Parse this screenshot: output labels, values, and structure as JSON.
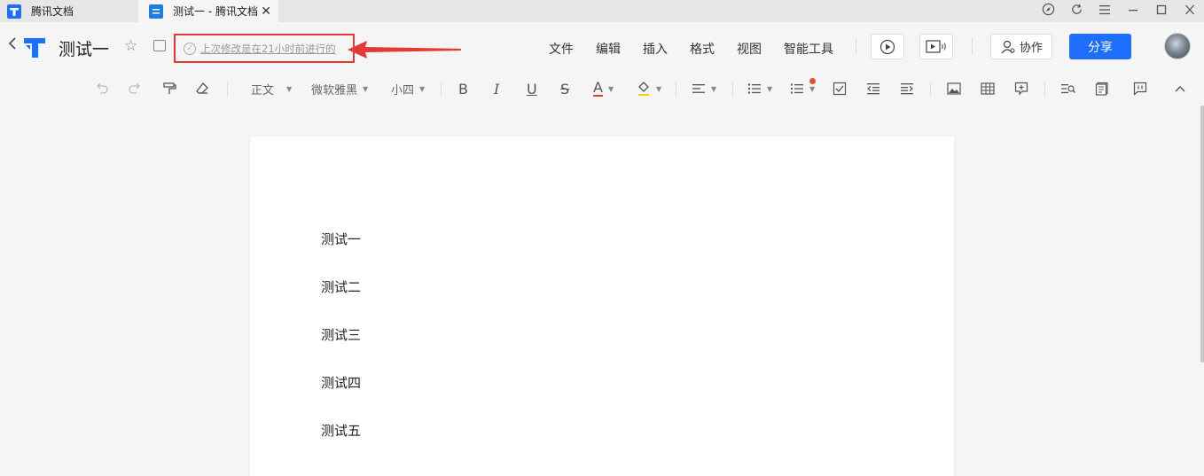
{
  "tabs": [
    {
      "label": "腾讯文档"
    },
    {
      "label": "测试一 - 腾讯文档"
    }
  ],
  "header": {
    "doc_title": "测试一",
    "status_text": "上次修改是在21小时前进行的",
    "menu": [
      "文件",
      "编辑",
      "插入",
      "格式",
      "视图",
      "智能工具"
    ],
    "collab_label": "协作",
    "share_label": "分享"
  },
  "toolbar": {
    "style_value": "正文",
    "font_value": "微软雅黑",
    "size_value": "小四",
    "bold": "B",
    "italic": "I",
    "underline": "U",
    "strike": "S",
    "font_color": "A"
  },
  "document": {
    "paragraphs": [
      "测试一",
      "测试二",
      "测试三",
      "测试四",
      "测试五"
    ]
  },
  "colors": {
    "accent": "#1e6fff",
    "annotation": "#e53935",
    "badge": "#e8512e"
  }
}
